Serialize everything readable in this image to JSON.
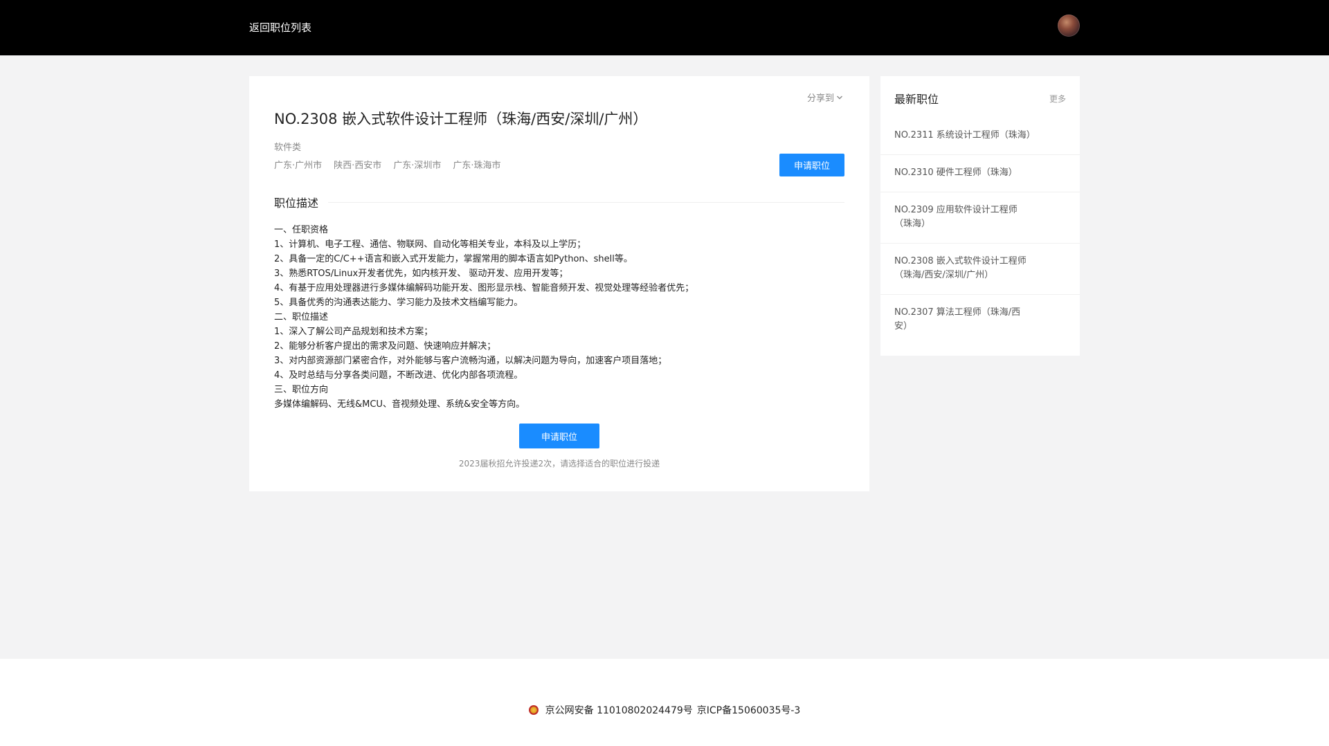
{
  "header": {
    "back_label": "返回职位列表"
  },
  "job": {
    "share_label": "分享到",
    "title": "NO.2308 嵌入式软件设计工程师（珠海/西安/深圳/广州）",
    "category": "软件类",
    "locations": [
      "广东·广州市",
      "陕西·西安市",
      "广东·深圳市",
      "广东·珠海市"
    ],
    "apply_label": "申请职位",
    "section_title": "职位描述",
    "description": [
      "一、任职资格",
      "1、计算机、电子工程、通信、物联网、自动化等相关专业，本科及以上学历；",
      "2、具备一定的C/C++语言和嵌入式开发能力，掌握常用的脚本语言如Python、shell等。",
      "3、熟悉RTOS/Linux开发者优先，如内核开发、 驱动开发、应用开发等；",
      "4、有基于应用处理器进行多媒体编解码功能开发、图形显示栈、智能音频开发、视觉处理等经验者优先；",
      "5、具备优秀的沟通表达能力、学习能力及技术文档编写能力。",
      "二、职位描述",
      "1、深入了解公司产品规划和技术方案；",
      "2、能够分析客户提出的需求及问题、快速响应并解决；",
      "3、对内部资源部门紧密合作，对外能够与客户流畅沟通，以解决问题为导向，加速客户项目落地；",
      "4、及时总结与分享各类问题，不断改进、优化内部各项流程。",
      "三、职位方向",
      "多媒体编解码、无线&MCU、音视频处理、系统&安全等方向。"
    ],
    "apply_bottom_label": "申请职位",
    "apply_hint": "2023届秋招允许投递2次，请选择适合的职位进行投递"
  },
  "sidebar": {
    "title": "最新职位",
    "more_label": "更多",
    "items": [
      {
        "label": "NO.2311 系统设计工程师（珠海）"
      },
      {
        "label": "NO.2310 硬件工程师（珠海）"
      },
      {
        "label": "NO.2309 应用软件设计工程师（珠海）"
      },
      {
        "label": "NO.2308 嵌入式软件设计工程师（珠海/西安/深圳/广州）"
      },
      {
        "label": "NO.2307 算法工程师（珠海/西安）"
      }
    ]
  },
  "footer": {
    "police_record": "京公网安备 11010802024479号",
    "icp_record": "京ICP备15060035号-3"
  },
  "colors": {
    "accent": "#1a8cff",
    "topbar": "#000000",
    "page_bg": "#f3f3f4"
  },
  "icons": {
    "share": "chevron-down-icon",
    "footer": "police-emblem-icon"
  }
}
